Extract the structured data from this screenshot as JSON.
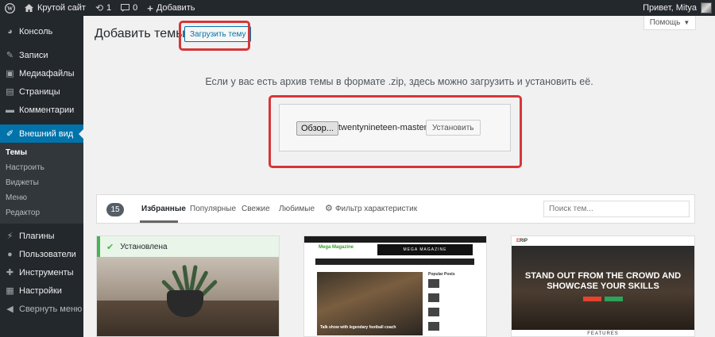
{
  "adminbar": {
    "site_name": "Крутой сайт",
    "updates_count": "1",
    "comments_count": "0",
    "add_new_label": "Добавить",
    "greeting": "Привет, Mitya"
  },
  "sidebar": {
    "items": [
      {
        "label": "Консоль",
        "icon": "dashboard-icon"
      },
      {
        "label": "Записи",
        "icon": "pin-icon"
      },
      {
        "label": "Медиафайлы",
        "icon": "media-icon"
      },
      {
        "label": "Страницы",
        "icon": "page-icon"
      },
      {
        "label": "Комментарии",
        "icon": "comment-icon"
      },
      {
        "label": "Внешний вид",
        "icon": "brush-icon"
      },
      {
        "label": "Плагины",
        "icon": "plugin-icon"
      },
      {
        "label": "Пользователи",
        "icon": "user-icon"
      },
      {
        "label": "Инструменты",
        "icon": "wrench-icon"
      },
      {
        "label": "Настройки",
        "icon": "settings-icon"
      },
      {
        "label": "Свернуть меню",
        "icon": "collapse-icon"
      }
    ],
    "submenu": [
      "Темы",
      "Настроить",
      "Виджеты",
      "Меню",
      "Редактор"
    ]
  },
  "main": {
    "title": "Добавить темы",
    "upload_button": "Загрузить тему",
    "help_button": "Помощь",
    "description": "Если у вас есть архив темы в формате .zip, здесь можно загрузить и установить её.",
    "browse_button": "Обзор...",
    "file_name": "twentynineteen-master.zip",
    "install_button": "Установить"
  },
  "filters": {
    "count": "15",
    "tabs": [
      "Избранные",
      "Популярные",
      "Свежие",
      "Любимые"
    ],
    "feature_filter": "Фильтр характеристик",
    "search_placeholder": "Поиск тем..."
  },
  "themes": {
    "installed_label": "Установлена",
    "mag_logo": "Mega Magazine",
    "mag_banner": "MEGA MAGAZINE",
    "mag_caption": "Talk show with legendary football coach",
    "mag_popular": "Popular Posts",
    "erip_logo_accent": "E",
    "erip_logo_rest": "RIP",
    "erip_hero_line1": "STAND OUT FROM THE CROWD AND",
    "erip_hero_line2": "SHOWCASE YOUR SKILLS",
    "erip_features": "FEATURES"
  },
  "colors": {
    "accent": "#0073aa",
    "highlight": "#d63638",
    "installed": "#46b450",
    "sidebar": "#23282d"
  }
}
